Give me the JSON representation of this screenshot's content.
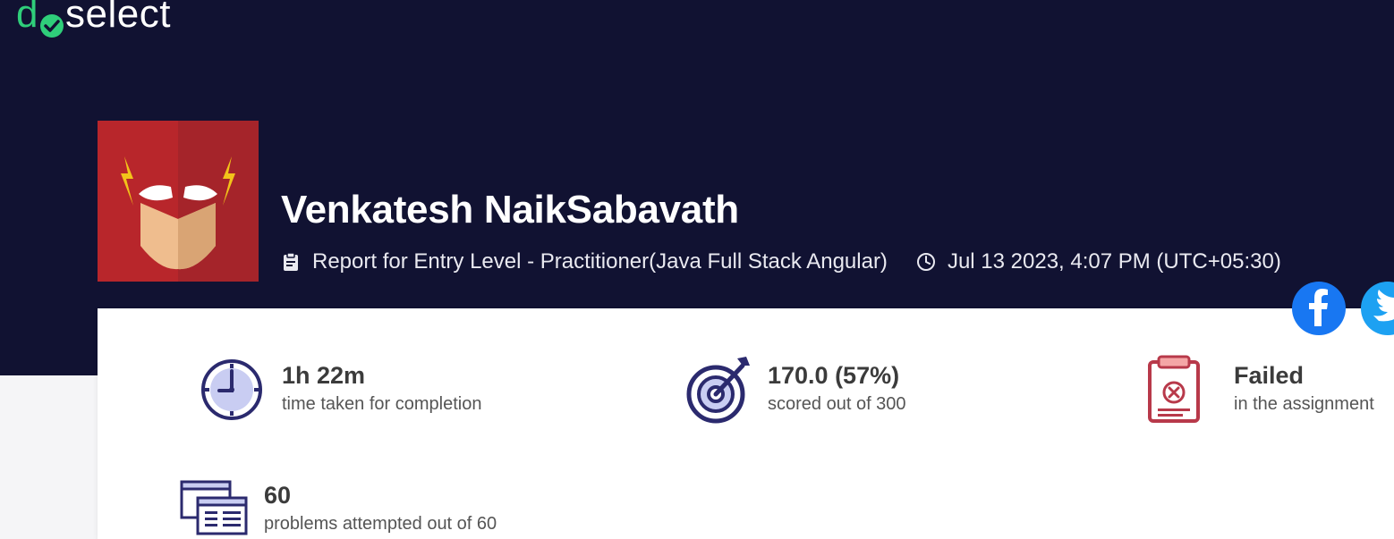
{
  "brand": {
    "logo_prefix": "d",
    "logo_suffix": "select",
    "accent": "#2fce7a"
  },
  "header": {
    "background": "#111232",
    "candidate_name": "Venkatesh NaikSabavath",
    "report_title": "Report for Entry Level - Practitioner(Java Full Stack Angular)",
    "report_icon": "clipboard-icon",
    "timestamp": "Jul 13 2023, 4:07 PM (UTC+05:30)",
    "timestamp_icon": "clock-icon"
  },
  "share": {
    "facebook_icon": "facebook-icon",
    "twitter_icon": "twitter-icon"
  },
  "stats": {
    "time": {
      "value": "1h 22m",
      "label": "time taken for completion",
      "icon": "stopwatch-icon"
    },
    "score": {
      "value": "170.0 (57%)",
      "label": "scored out of 300",
      "icon": "target-icon"
    },
    "result": {
      "value": "Failed",
      "label": "in the assignment",
      "icon": "failed-clipboard-icon",
      "color": "#b8394a"
    },
    "problems": {
      "value": "60",
      "label": "problems attempted out of 60",
      "icon": "windows-icon"
    }
  }
}
